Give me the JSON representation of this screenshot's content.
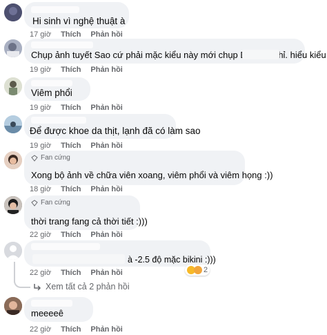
{
  "meta_actions": {
    "like": "Thích",
    "reply": "Phản hồi"
  },
  "badge": {
    "fan": "Fan cứng"
  },
  "comments": [
    {
      "text": "Hi sinh vì nghệ thuật à",
      "time": "17 giờ"
    },
    {
      "text": "Chụp ảnh tuyết Sao cứ phải mặc kiểu này mới chụp DC ảnh nhỉ.        hiểu kiểu j",
      "time": "19 giờ"
    },
    {
      "text": "Viêm phổi",
      "time": "19 giờ"
    },
    {
      "text": "Để được khoe da thịt, lạnh đã có làm sao",
      "time": "19 giờ"
    },
    {
      "text": "Xong bộ ảnh về chữa viên xoang, viêm phổi và viêm họng :))",
      "time": "18 giờ"
    },
    {
      "text": "thời trang fang cả thời tiết :)))",
      "time": "22 giờ"
    },
    {
      "text": "à -2.5 độ mặc bikini :)))",
      "time": "22 giờ",
      "reaction_count": "2"
    },
    {
      "text": "meeeeê",
      "time": "22 giờ"
    }
  ],
  "view_replies": "Xem tất cả 2 phản hồi"
}
